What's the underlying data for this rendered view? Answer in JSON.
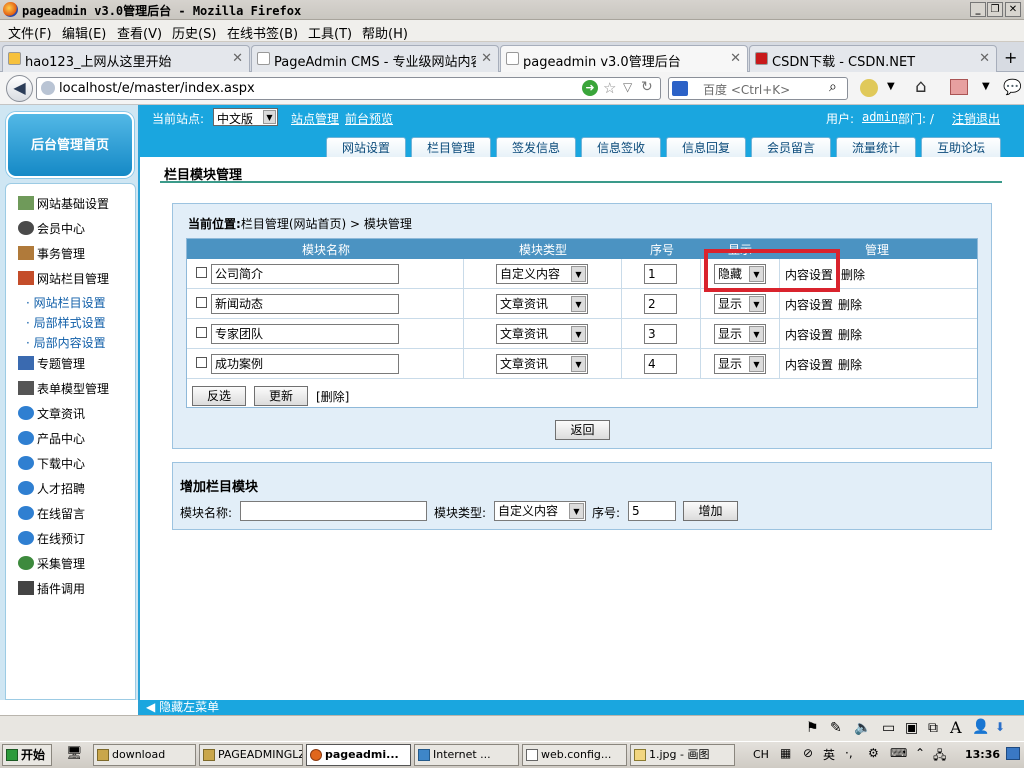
{
  "window": {
    "title": "pageadmin v3.0管理后台 - Mozilla Firefox"
  },
  "menu": [
    "文件(F)",
    "编辑(E)",
    "查看(V)",
    "历史(S)",
    "在线书签(B)",
    "工具(T)",
    "帮助(H)"
  ],
  "tabs": [
    {
      "label": "hao123_上网从这里开始"
    },
    {
      "label": "PageAdmin CMS - 专业级网站内容..."
    },
    {
      "label": "pageadmin v3.0管理后台"
    },
    {
      "label": "CSDN下载 - CSDN.NET"
    }
  ],
  "address": {
    "url": "localhost/e/master/index.aspx",
    "search_placeholder": "百度 <Ctrl+K>"
  },
  "app": {
    "home_button": "后台管理首页",
    "site_label": "当前站点:",
    "site_value": "中文版",
    "site_manage": "站点管理",
    "preview": "前台预览",
    "user_label": "用户:",
    "user_name": "admin",
    "dept_label": "部门: /",
    "logout": "注销退出",
    "nav_tabs": [
      "网站设置",
      "栏目管理",
      "签发信息",
      "信息签收",
      "信息回复",
      "会员留言",
      "流量统计",
      "互助论坛"
    ],
    "sidebar": [
      {
        "label": "网站基础设置"
      },
      {
        "label": "会员中心"
      },
      {
        "label": "事务管理"
      },
      {
        "label": "网站栏目管理"
      },
      {
        "label": "· 网站栏目设置"
      },
      {
        "label": "· 局部样式设置"
      },
      {
        "label": "· 局部内容设置"
      },
      {
        "label": "专题管理"
      },
      {
        "label": "表单模型管理"
      },
      {
        "label": "文章资讯"
      },
      {
        "label": "产品中心"
      },
      {
        "label": "下载中心"
      },
      {
        "label": "人才招聘"
      },
      {
        "label": "在线留言"
      },
      {
        "label": "在线预订"
      },
      {
        "label": "采集管理"
      },
      {
        "label": "插件调用"
      }
    ],
    "page_title": "栏目模块管理",
    "breadcrumb_label": "当前位置:",
    "breadcrumb": "栏目管理(网站首页) > 模块管理",
    "table": {
      "headers": [
        "模块名称",
        "模块类型",
        "序号",
        "显示",
        "管理"
      ],
      "rows": [
        {
          "name": "公司简介",
          "type": "自定义内容",
          "order": "1",
          "display": "隐藏",
          "action1": "内容设置",
          "action2": "删除"
        },
        {
          "name": "新闻动态",
          "type": "文章资讯",
          "order": "2",
          "display": "显示",
          "action1": "内容设置",
          "action2": "删除"
        },
        {
          "name": "专家团队",
          "type": "文章资讯",
          "order": "3",
          "display": "显示",
          "action1": "内容设置",
          "action2": "删除"
        },
        {
          "name": "成功案例",
          "type": "文章资讯",
          "order": "4",
          "display": "显示",
          "action1": "内容设置",
          "action2": "删除"
        }
      ]
    },
    "buttons": {
      "invert": "反选",
      "update": "更新",
      "delete": "[删除]",
      "back": "返回",
      "add": "增加"
    },
    "add_form": {
      "title": "增加栏目模块",
      "name_label": "模块名称:",
      "name_value": "",
      "type_label": "模块类型:",
      "type_value": "自定义内容",
      "order_label": "序号:",
      "order_value": "5"
    },
    "hide_menu": "隐藏左菜单"
  },
  "taskbar": {
    "start": "开始",
    "items": [
      "download",
      "PAGEADMINGLZX",
      "pageadmi...",
      "Internet ...",
      "web.config...",
      "1.jpg - 画图"
    ],
    "lang": "CH",
    "clock": "13:36"
  },
  "colors": {
    "accent": "#1aa6df",
    "highlight": "#d9232d",
    "table_header": "#4b93c2"
  }
}
